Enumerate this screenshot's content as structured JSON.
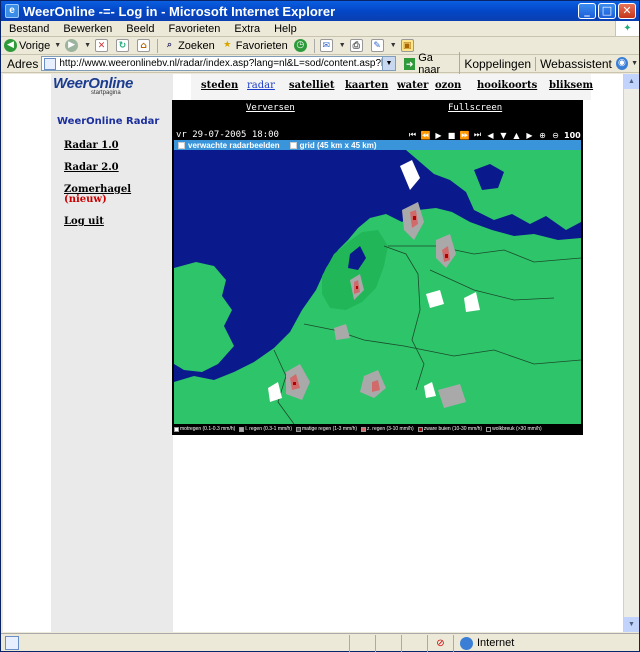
{
  "window": {
    "title": "WeerOnline -=- Log in - Microsoft Internet Explorer",
    "app_icon_glyph": "e",
    "min_glyph": "_",
    "max_glyph": "□",
    "close_glyph": "✕"
  },
  "menu": {
    "items": [
      "Bestand",
      "Bewerken",
      "Beeld",
      "Favorieten",
      "Extra",
      "Help"
    ]
  },
  "toolbar": {
    "back_label": "Vorige",
    "search_label": "Zoeken",
    "favorites_label": "Favorieten",
    "icons": [
      "back-arrow-icon",
      "forward-arrow-icon",
      "stop-icon",
      "refresh-icon",
      "home-icon",
      "search-icon",
      "favorites-star-icon",
      "history-icon",
      "mail-icon",
      "print-icon",
      "edit-icon",
      "messenger-icon"
    ]
  },
  "address": {
    "label": "Adres",
    "url": "http://www.weeronlinebv.nl/radar/index.asp?lang=nl&L=sod/content.asp?lang=nl",
    "go_label": "Ga naar",
    "links_label": "Koppelingen",
    "webassist_label": "Webassistent"
  },
  "status": {
    "zone_label": "Internet"
  },
  "logo": {
    "name": "WeerOnline",
    "tagline": "startpagina"
  },
  "sidebar": {
    "title": "WeerOnline Radar",
    "links": [
      "Radar 1.0",
      "Radar 2.0",
      "Zomerhagel"
    ],
    "new_badge": "(nieuw)",
    "logout": "Log uit"
  },
  "nav": {
    "items": [
      "steden",
      "radar",
      "satelliet",
      "kaarten",
      "water",
      "ozon",
      "hooikoorts",
      "bliksem"
    ],
    "active": "radar"
  },
  "radar": {
    "refresh_label": "Verversen",
    "fullscreen_label": "Fullscreen",
    "date_label": "vr 29-07-2005 18:00",
    "zoom_value": "100",
    "option_forecast": "verwachte radarbeelden",
    "option_grid": "grid (45 km x 45 km)",
    "legend": [
      {
        "label": "motregen (0.1-0.3 mm/h)",
        "color": "#ffffff"
      },
      {
        "label": "l. regen (0.3-1 mm/h)",
        "color": "#a9a9a9"
      },
      {
        "label": "matige regen (1-3 mm/h)",
        "color": "#4d4d4d"
      },
      {
        "label": "z. regen (3-10 mm/h)",
        "color": "#d16b6b"
      },
      {
        "label": "zware buien (10-30 mm/h)",
        "color": "#b00000"
      },
      {
        "label": "wolkbreuk (>30 mm/h)",
        "color": "#000000"
      }
    ],
    "colors": {
      "sea": "#0a1a8c",
      "land": "#2ec46a",
      "nl_land": "#21b658"
    }
  }
}
